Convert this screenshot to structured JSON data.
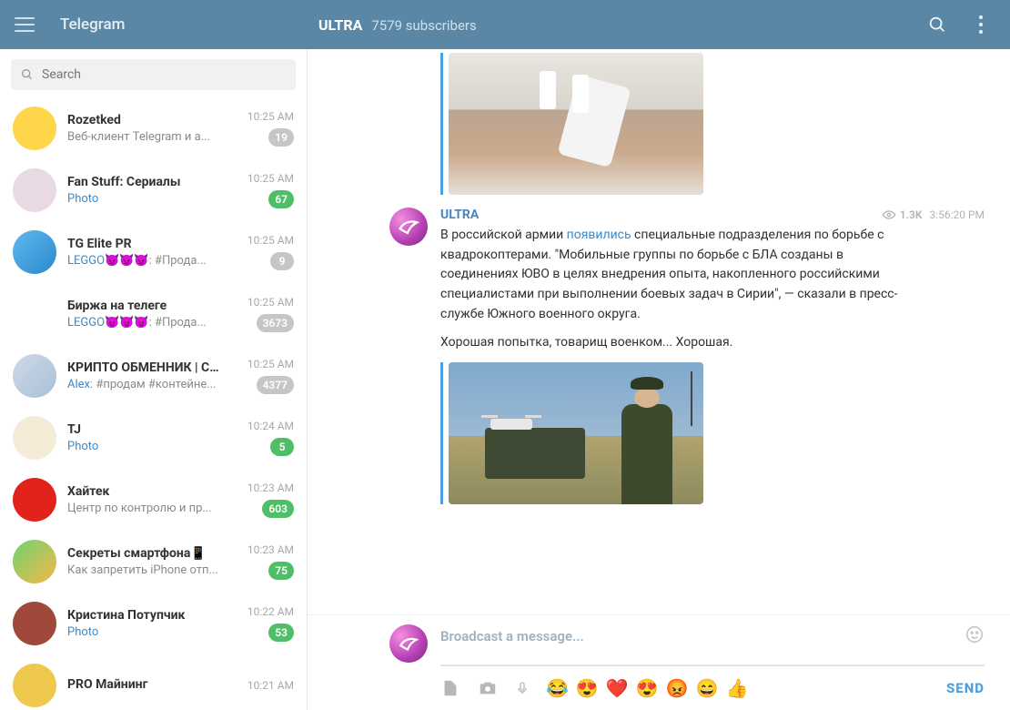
{
  "header": {
    "brand": "Telegram",
    "channel_title": "ULTRA",
    "subscribers": "7579 subscribers"
  },
  "search": {
    "placeholder": "Search"
  },
  "chats": [
    {
      "name": "Rozetked",
      "preview": "Веб-клиент Telegram и а...",
      "preview_hl": "",
      "time": "10:25 AM",
      "badge": "19",
      "badge_color": "#c6c6c6",
      "av_bg": "#ffd54a",
      "av_txt": ""
    },
    {
      "name": "Fan Stuff: Сериалы",
      "preview": "",
      "preview_hl": "Photo",
      "time": "10:25 AM",
      "badge": "67",
      "badge_color": "#4fbf67",
      "av_bg": "#e8d9e3",
      "av_txt": ""
    },
    {
      "name": "TG Elite PR",
      "preview": "😈😈😈: #Прода...",
      "preview_hl": "LEGGO",
      "time": "10:25 AM",
      "badge": "9",
      "badge_color": "#c6c6c6",
      "av_bg": "linear-gradient(135deg,#5fb7ef,#2a8acb)",
      "av_txt": ""
    },
    {
      "name": "Биржа на телеге",
      "preview": "😈😈😈: #Прода...",
      "preview_hl": "LEGGO",
      "time": "10:25 AM",
      "badge": "3673",
      "badge_color": "#c6c6c6",
      "av_bg": "#fff",
      "av_txt": ""
    },
    {
      "name": "КРИПТО ОБМЕННИК | СНГ",
      "preview": ": #продам #контейне...",
      "preview_hl": "Alex",
      "time": "10:25 AM",
      "badge": "4377",
      "badge_color": "#c6c6c6",
      "av_bg": "linear-gradient(135deg,#cfd9e8,#a8c0d8)",
      "av_txt": ""
    },
    {
      "name": "TJ",
      "preview": "",
      "preview_hl": "Photo",
      "time": "10:24 AM",
      "badge": "5",
      "badge_color": "#4fbf67",
      "av_bg": "#f5ecd8",
      "av_txt": ""
    },
    {
      "name": "Хайтек",
      "preview": "Центр по контролю и пр...",
      "preview_hl": "",
      "time": "10:23 AM",
      "badge": "603",
      "badge_color": "#4fbf67",
      "av_bg": "#e2231a",
      "av_txt": ""
    },
    {
      "name": "Секреты смартфона📱",
      "preview": "Как запретить iPhone отп...",
      "preview_hl": "",
      "time": "10:23 AM",
      "badge": "75",
      "badge_color": "#4fbf67",
      "av_bg": "linear-gradient(135deg,#6fd36f,#f5b84a)",
      "av_txt": ""
    },
    {
      "name": "Кристина Потупчик",
      "preview": "",
      "preview_hl": "Photo",
      "time": "10:22 AM",
      "badge": "53",
      "badge_color": "#4fbf67",
      "av_bg": "#a0493b",
      "av_txt": ""
    },
    {
      "name": "PRO Майнинг",
      "preview": "",
      "preview_hl": "",
      "time": "10:21 AM",
      "badge": "",
      "badge_color": "",
      "av_bg": "#efc84e",
      "av_txt": ""
    }
  ],
  "message": {
    "author": "ULTRA",
    "views": "1.3K",
    "time": "3:56:20 PM",
    "p1a": "В российской армии ",
    "p1link": "появились",
    "p1b": " специальные подразделения по борьбе с квадрокоптерами. \"Мобильные группы по борьбе с БЛА созданы в соединениях ЮВО в целях внедрения опыта, накопленного российскими специалистами при выполнении боевых задач в Сирии\", — сказали в пресс-службе Южного военного округа.",
    "p2": "Хорошая попытка, товарищ военком... Хорошая."
  },
  "composer": {
    "placeholder": "Broadcast a message...",
    "send": "SEND",
    "emojis": [
      "😂",
      "😍",
      "❤️",
      "😍",
      "😡",
      "😄",
      "👍"
    ]
  }
}
